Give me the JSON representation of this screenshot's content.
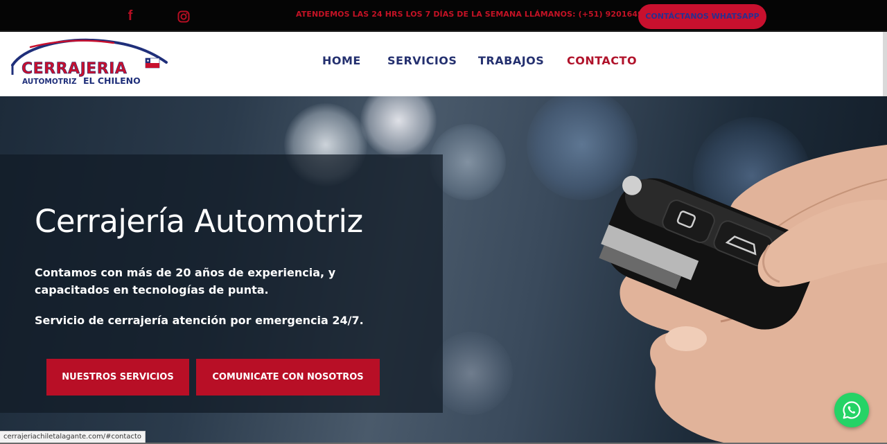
{
  "topbar": {
    "facebook_icon": "facebook-icon",
    "instagram_icon": "instagram-icon",
    "message": "ATENDEMOS LAS 24 HRS LOS 7 DÍAS DE LA SEMANA LLÁMANOS: (+51) 920164983",
    "whatsapp_button": "CONTÁCTANOS WHATSAPP"
  },
  "logo": {
    "line1": "CERRAJERIA",
    "line2a": "AUTOMOTRIZ",
    "line2b": "EL CHILENO"
  },
  "nav": {
    "items": [
      {
        "label": "HOME",
        "active": false
      },
      {
        "label": "SERVICIOS",
        "active": false
      },
      {
        "label": "TRABAJOS",
        "active": false
      },
      {
        "label": "CONTACTO",
        "active": true
      }
    ]
  },
  "hero": {
    "title": "Cerrajería Automotriz",
    "paragraph1": "Contamos con más de 20 años de experiencia, y capacitados en tecnologías de punta.",
    "paragraph2": "Servicio de cerrajería atención por emergencia 24/7.",
    "button_services": "NUESTROS SERVICIOS",
    "button_contact": "COMUNICATE CON NOSOTROS"
  },
  "floating": {
    "whatsapp_icon": "whatsapp-icon"
  },
  "status_bar": {
    "url": "cerrajeriachiletalagante.com/#contacto"
  },
  "colors": {
    "brand_red": "#c8102e",
    "brand_navy": "#24306f",
    "topbar_bg": "#050505",
    "whatsapp_green": "#25d366"
  }
}
